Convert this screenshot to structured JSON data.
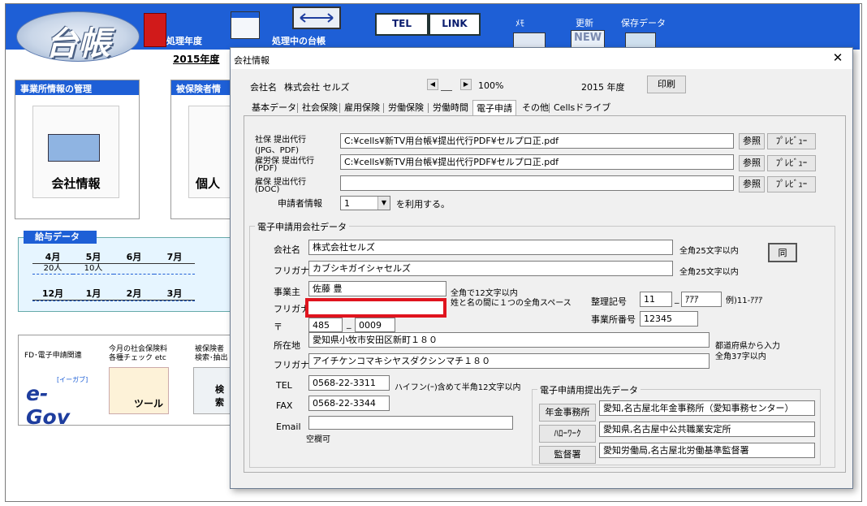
{
  "top": {
    "logo_text": "台帳",
    "labels": {
      "year_menu": "処理年度",
      "current_book": "処理中の台帳"
    },
    "buttons": {
      "tel": "TEL",
      "link": "LINK"
    },
    "menu": {
      "memo": "ﾒﾓ",
      "update": "更新",
      "saved": "保存データ"
    },
    "year_label": "2015年度"
  },
  "sections": {
    "office_mgmt": "事業所情報の管理",
    "insured_mgmt": "被保険者情",
    "company_info": "会社情報",
    "individual": "個人"
  },
  "salary": {
    "header": "給与データ",
    "row1": [
      {
        "month": "4月",
        "value": "20人"
      },
      {
        "month": "5月",
        "value": "10人"
      },
      {
        "month": "6月",
        "value": ""
      },
      {
        "month": "7月",
        "value": ""
      }
    ],
    "row2": [
      {
        "month": "12月"
      },
      {
        "month": "1月"
      },
      {
        "month": "2月"
      },
      {
        "month": "3月"
      }
    ]
  },
  "bottom": {
    "fd_label": "FD･電子申請関連",
    "egov_small": "[イーガブ]",
    "egov_big": "e-Gov",
    "check_label1": "今月の社会保険料",
    "check_label2": "各種チェック etc",
    "tool_label": "ツール",
    "search_label1": "被保険者",
    "search_label2": "検索･抽出",
    "search_btn": "検索"
  },
  "dialog": {
    "title": "会社情報",
    "company_label": "会社名",
    "company_name": "株式会社 セルズ",
    "zoom": "100%",
    "year": "2015 年度",
    "print": "印刷",
    "tabs": [
      "基本データ",
      "社会保険",
      "雇用保険",
      "労働保険",
      "労働時間",
      "電子申請",
      "その他",
      "Cellsドライブ"
    ],
    "active_tab": 5,
    "proxy": {
      "rows": [
        {
          "label1": "社保 提出代行",
          "label2": "(JPG、PDF)",
          "value": "C:¥cells¥新TV用台帳¥提出代行PDF¥セルプロ正.pdf"
        },
        {
          "label1": "雇労保 提出代行",
          "label2": "(PDF)",
          "value": "C:¥cells¥新TV用台帳¥提出代行PDF¥セルプロ正.pdf"
        },
        {
          "label1": "雇保 提出代行",
          "label2": "(DOC)",
          "value": ""
        }
      ],
      "browse": "参照",
      "preview": "ﾌﾟﾚﾋﾞｭｰ",
      "applicant_label": "申請者情報",
      "applicant_value": "1",
      "applicant_suffix": "を利用する。"
    },
    "egov_group": {
      "title": "電子申請用会社データ",
      "company_label": "会社名",
      "company_value": "株式会社セルズ",
      "company_note": "全角25文字以内",
      "furigana_label": "フリガナ",
      "furigana_value": "カブシキガイシャセルズ",
      "furigana_note": "全角25文字以内",
      "same_btn": "同",
      "owner_label": "事業主",
      "owner_value": "佐藤 豊",
      "owner_note1": "全角で12文字以内",
      "owner_note2": "姓と名の間に１つの全角スペース",
      "owner_kana_label": "フリガナ",
      "owner_kana_value": "",
      "seiri_label": "整理記号",
      "seiri_1": "11",
      "seiri_2": "ｱｱｱ",
      "seiri_example": "例)11-ｱｱｱ",
      "office_no_label": "事業所番号",
      "office_no_value": "12345",
      "zip_label": "〒",
      "zip_1": "485",
      "zip_2": "0009",
      "address_label": "所在地",
      "address_value": "愛知県小牧市安田区新町１８０",
      "address_note1": "都道府県から入力",
      "address_note2": "全角37字以内",
      "address_kana_label": "フリガナ",
      "address_kana_value": "アイチケンコマキシヤスダクシンマチ１８０",
      "tel_label": "TEL",
      "tel_value": "0568-22-3311",
      "tel_note": "ハイフン(ｰ)含めて半角12文字以内",
      "fax_label": "FAX",
      "fax_value": "0568-22-3344",
      "email_label": "Email",
      "email_value": "",
      "email_note": "空欄可"
    },
    "submit_group": {
      "title": "電子申請用提出先データ",
      "rows": [
        {
          "button": "年金事務所",
          "value": "愛知,名古屋北年金事務所（愛知事務センター）"
        },
        {
          "button": "ﾊﾛｰﾜｰｸ",
          "value": "愛知県,名古屋中公共職業安定所"
        },
        {
          "button": "監督署",
          "value": "愛知労働局,名古屋北労働基準監督署"
        }
      ]
    },
    "highlight_color": "#e0141e"
  }
}
